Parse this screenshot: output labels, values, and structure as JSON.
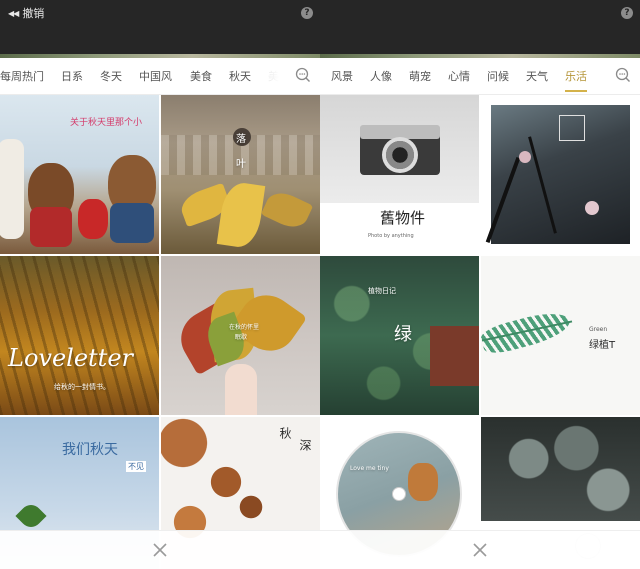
{
  "app": {
    "undo_label": "撤销",
    "undo_icon": "double-left-arrow-icon",
    "help_glyph": "?",
    "accent_color": "#d4b24a"
  },
  "left_panel": {
    "tabs": [
      "每周热门",
      "日系",
      "冬天",
      "中国风",
      "美食",
      "秋天",
      "美"
    ],
    "tiles": [
      {
        "caption": "关于秋天里那个小",
        "label": "teddy-bears"
      },
      {
        "caption": "落",
        "caption2": "叶",
        "label": "fallen-leaves"
      },
      {
        "caption": "Loveletter",
        "caption2": "给秋的一封情书。",
        "label": "autumn-forest"
      },
      {
        "caption": "在秋的怀里",
        "caption2": "眠歇",
        "label": "hand-holding-leaves"
      },
      {
        "caption": "我们秋天",
        "caption2": "不见",
        "label": "winter-sky"
      },
      {
        "caption": "秋",
        "caption2": "深",
        "label": "maple-branches"
      }
    ]
  },
  "right_panel": {
    "tabs": [
      "风景",
      "人像",
      "萌宠",
      "心情",
      "问候",
      "天气",
      "乐活"
    ],
    "active_tab": "乐活",
    "tiles": [
      {
        "caption": "舊物件",
        "caption2": "Photo by anything",
        "label": "vintage-camera"
      },
      {
        "caption": "",
        "label": "dark-flowers"
      },
      {
        "caption": "绿",
        "caption2": "植物日记",
        "label": "green-leaves"
      },
      {
        "caption": "绿植T",
        "caption2": "Green",
        "label": "fern-leaf"
      },
      {
        "caption": "Love me tiny",
        "label": "cat-disc"
      },
      {
        "caption": "",
        "label": "dark-foliage"
      }
    ]
  },
  "bottom": {
    "close_glyph": "×"
  }
}
